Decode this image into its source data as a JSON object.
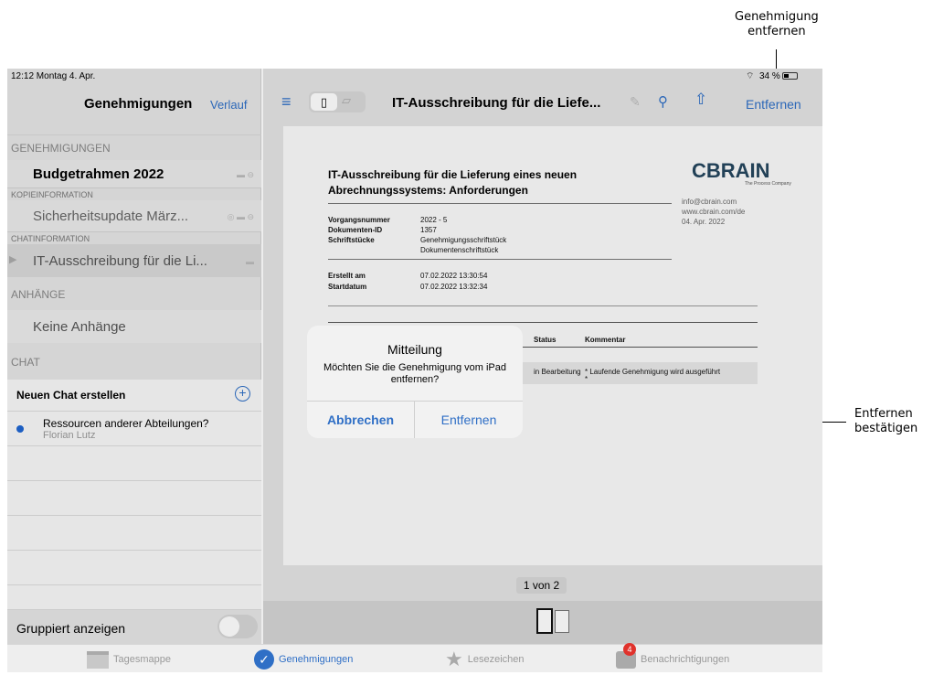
{
  "annotations": {
    "top_callout": "Genehmigung\nentfernen",
    "side_callout": "Entfernen\nbestätigen"
  },
  "status_bar": {
    "time_date": "12:12  Montag 4. Apr.",
    "battery": "34 %"
  },
  "left_pane": {
    "title": "Genehmigungen",
    "history_link": "Verlauf",
    "sections": {
      "approvals": "GENEHMIGUNGEN",
      "copy_info": "KOPIEINFORMATION",
      "chat_info": "CHATINFORMATION",
      "attachments": "ANHÄNGE",
      "chat": "CHAT"
    },
    "items": {
      "budget": "Budgetrahmen 2022",
      "security": "Sicherheitsupdate März...",
      "it_tender": "IT-Ausschreibung für die Li...",
      "no_attachments": "Keine Anhänge"
    },
    "new_chat": "Neuen Chat erstellen",
    "chat_entry": {
      "title": "Ressourcen anderer Abteilungen?",
      "author": "Florian Lutz"
    },
    "group_toggle_label": "Gruppiert anzeigen",
    "group_toggle_on": false
  },
  "right_pane": {
    "title": "IT-Ausschreibung für die Liefe...",
    "remove_button": "Entfernen",
    "page_indicator": "1 von 2",
    "document": {
      "heading_line1": "IT-Ausschreibung für die Lieferung eines neuen",
      "heading_line2": "Abrechnungssystems: Anforderungen",
      "logo": "CBRAIN",
      "logo_sub": "The Process Company",
      "contact_email": "info@cbrain.com",
      "contact_web": "www.cbrain.com/de",
      "contact_date": "04. Apr. 2022",
      "fields": [
        {
          "label": "Vorgangsnummer",
          "value": "2022 - 5"
        },
        {
          "label": "Dokumenten-ID",
          "value": "1357"
        },
        {
          "label": "Schriftstücke",
          "value": "Genehmigungsschriftstück"
        },
        {
          "label": "",
          "value": "Dokumentenschriftstück"
        }
      ],
      "dates": [
        {
          "label": "Erstellt am",
          "value": "07.02.2022 13:30:54"
        },
        {
          "label": "Startdatum",
          "value": "07.02.2022 13:32:34"
        }
      ],
      "table_headers": {
        "status": "Status",
        "comment": "Kommentar"
      },
      "table_row": {
        "status": "in Bearbeitung",
        "comment": "* Laufende Genehmigung wird ausgeführt",
        "comment2": "*"
      }
    }
  },
  "dialog": {
    "title": "Mitteilung",
    "message": "Möchten Sie die Genehmigung vom iPad entfernen?",
    "cancel": "Abbrechen",
    "confirm": "Entfernen"
  },
  "tab_bar": {
    "tabs": [
      {
        "label": "Tagesmappe",
        "icon": "calendar-icon",
        "active": false
      },
      {
        "label": "Genehmigungen",
        "icon": "check-badge-icon",
        "active": true
      },
      {
        "label": "Lesezeichen",
        "icon": "star-icon",
        "active": false
      },
      {
        "label": "Benachrichtigungen",
        "icon": "chat-bubble-icon",
        "active": false,
        "badge": "4"
      }
    ]
  },
  "colors": {
    "accent": "#2f6fc6",
    "badge": "#e0322c",
    "unread_dot": "#1f66d1"
  }
}
